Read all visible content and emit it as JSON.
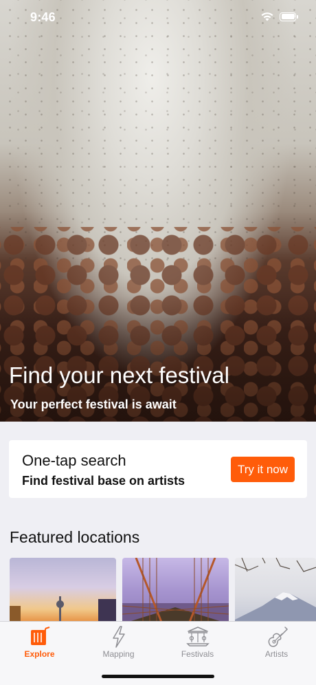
{
  "status_bar": {
    "time": "9:46",
    "icons": [
      "wifi-icon",
      "battery-icon"
    ]
  },
  "hero": {
    "title": "Find your next festival",
    "subtitle": "Your perfect festival is await"
  },
  "search_card": {
    "title": "One-tap search",
    "subtitle": "Find festival base on artists",
    "button_label": "Try it now"
  },
  "featured": {
    "title": "Featured locations",
    "cards": [
      "city-sunset-image",
      "bridge-image",
      "mountain-image"
    ]
  },
  "tab_bar": {
    "items": [
      {
        "label": "Explore",
        "icon": "explore-icon",
        "active": true
      },
      {
        "label": "Mapping",
        "icon": "lightning-icon",
        "active": false
      },
      {
        "label": "Festivals",
        "icon": "carousel-icon",
        "active": false
      },
      {
        "label": "Artists",
        "icon": "guitar-icon",
        "active": false
      }
    ]
  },
  "colors": {
    "accent": "#ff5c0a",
    "inactive": "#8e8e93",
    "background": "#efeff4"
  }
}
